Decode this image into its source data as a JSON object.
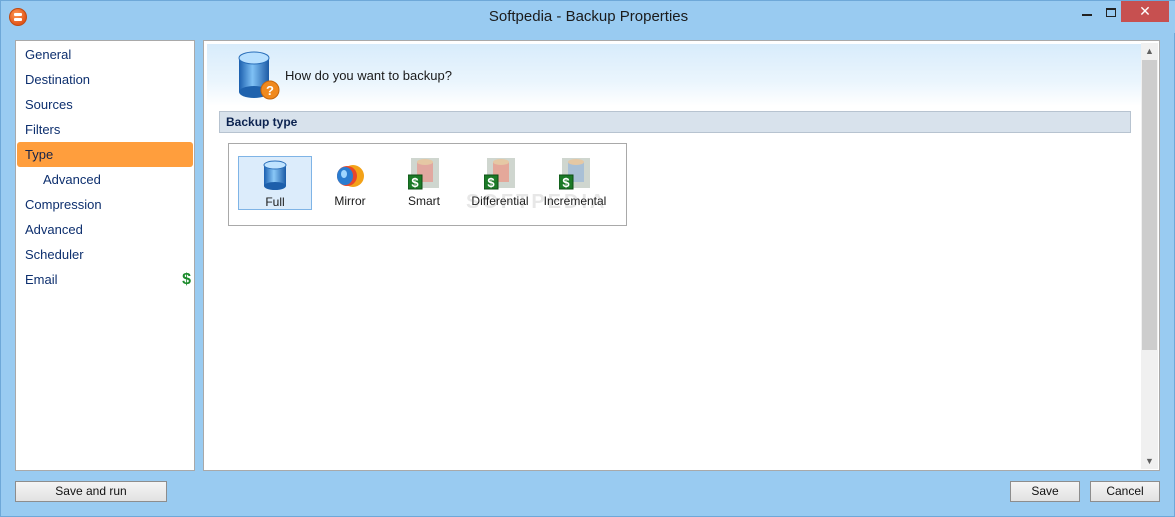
{
  "window": {
    "title": "Softpedia - Backup Properties",
    "close_label": "✕"
  },
  "sidebar": {
    "items": [
      {
        "label": "General"
      },
      {
        "label": "Destination"
      },
      {
        "label": "Sources"
      },
      {
        "label": "Filters"
      },
      {
        "label": "Type",
        "active": true
      },
      {
        "label": "Advanced",
        "sub": true
      },
      {
        "label": "Compression"
      },
      {
        "label": "Advanced"
      },
      {
        "label": "Scheduler"
      },
      {
        "label": "Email",
        "badge": "$"
      }
    ]
  },
  "main": {
    "header_text": "How do you want to backup?",
    "section_title": "Backup type",
    "backup_types": [
      {
        "label": "Full",
        "selected": true,
        "icon": "database-blue-icon"
      },
      {
        "label": "Mirror",
        "icon": "mirror-disc-icon"
      },
      {
        "label": "Smart",
        "icon": "database-locked-dollar-icon"
      },
      {
        "label": "Differential",
        "icon": "database-locked-dollar-icon"
      },
      {
        "label": "Incremental",
        "icon": "database-locked-dollar-icon"
      }
    ],
    "watermark": "SOFTPEDIA"
  },
  "buttons": {
    "save_and_run": "Save and run",
    "save": "Save",
    "cancel": "Cancel"
  },
  "colors": {
    "titlebar": "#99cbf1",
    "active_nav": "#ff9e3d",
    "nav_text": "#0d2f6e",
    "dollar_green": "#1a8a2a"
  }
}
